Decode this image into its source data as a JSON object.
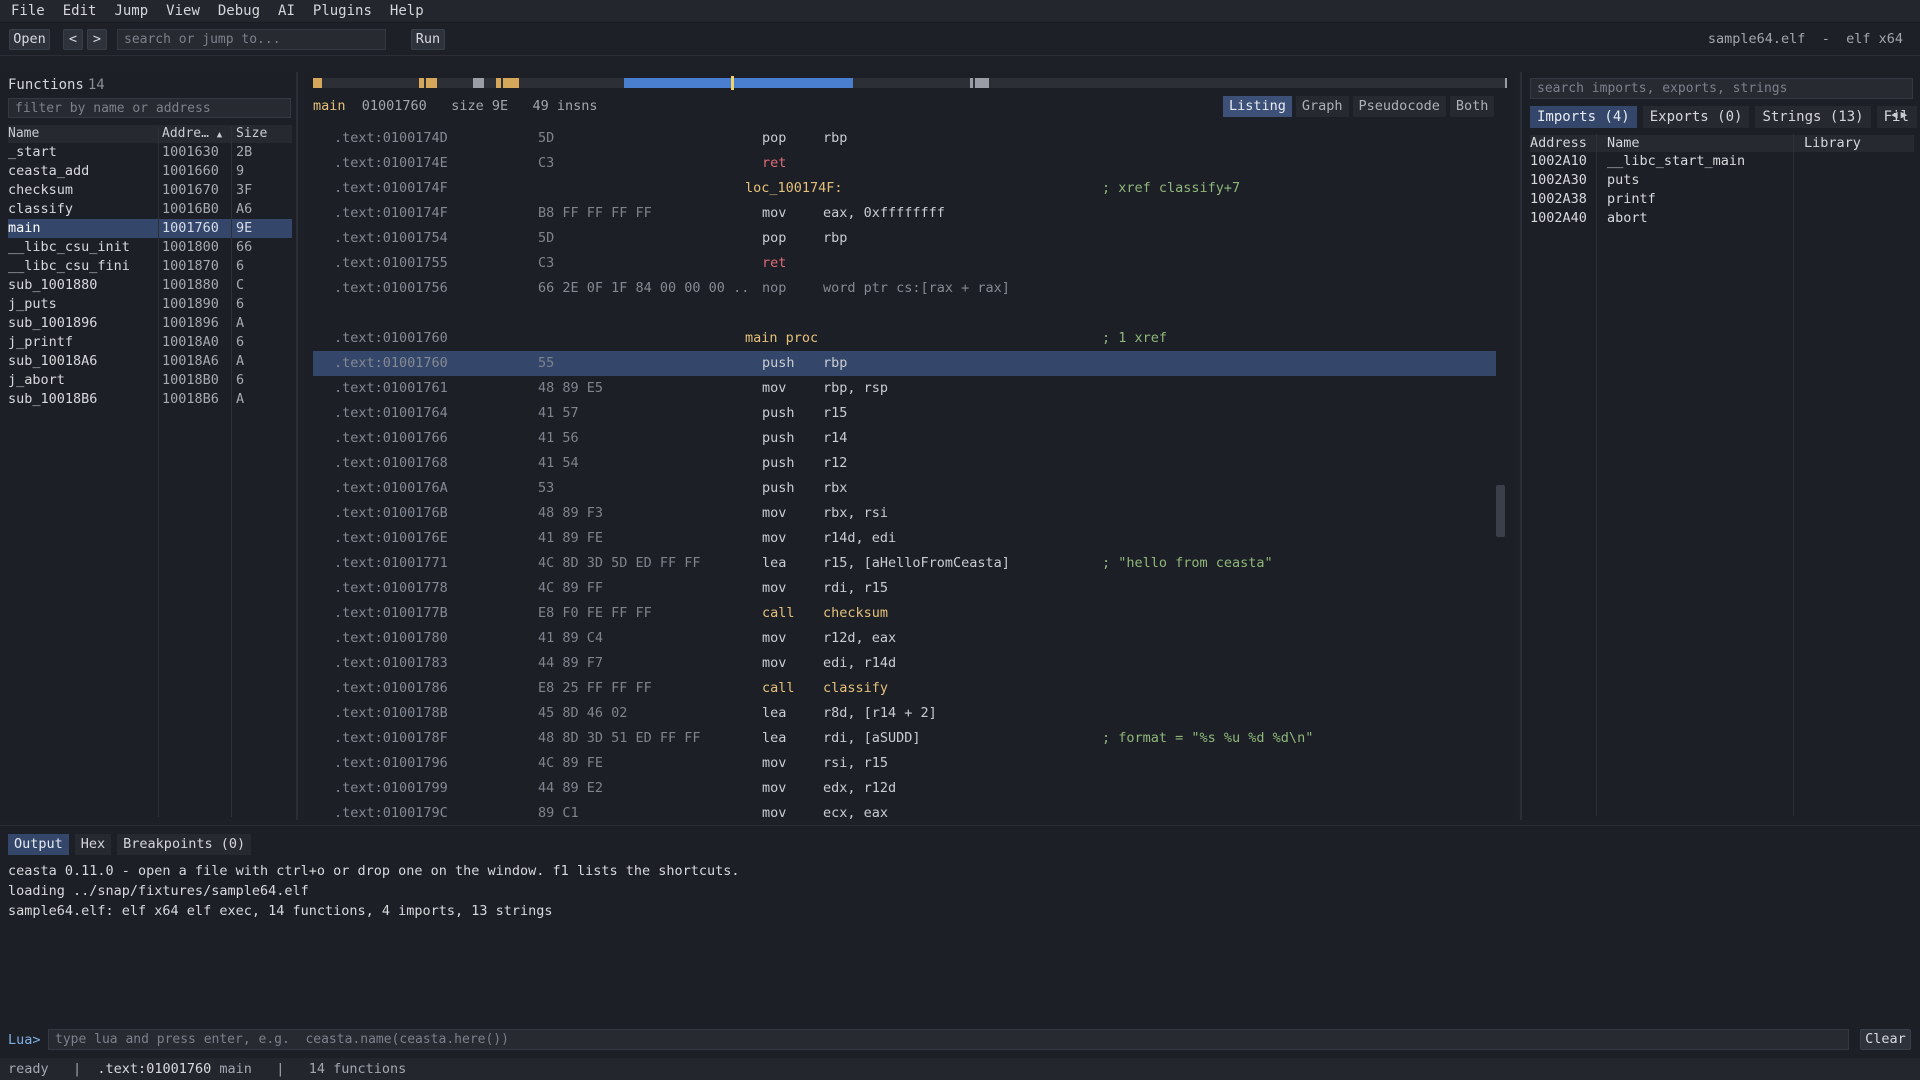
{
  "menubar": {
    "items": [
      "File",
      "Edit",
      "Jump",
      "View",
      "Debug",
      "AI",
      "Plugins",
      "Help"
    ]
  },
  "toolbar": {
    "open_label": "Open",
    "back_label": "<",
    "forward_label": ">",
    "search_placeholder": "search or jump to...",
    "run_label": "Run",
    "file_name": "sample64.elf",
    "file_sep": "  -  ",
    "file_format": "elf x64"
  },
  "functions": {
    "title": "Functions",
    "count": "14",
    "filter_placeholder": "filter by name or address",
    "columns": {
      "name": "Name",
      "address": "Addre…",
      "sort_indicator": "▲",
      "size": "Size"
    },
    "rows": [
      {
        "name": "_start",
        "address": "1001630",
        "size": "2B"
      },
      {
        "name": "ceasta_add",
        "address": "1001660",
        "size": "9"
      },
      {
        "name": "checksum",
        "address": "1001670",
        "size": "3F"
      },
      {
        "name": "classify",
        "address": "10016B0",
        "size": "A6"
      },
      {
        "name": "main",
        "address": "1001760",
        "size": "9E"
      },
      {
        "name": "__libc_csu_init",
        "address": "1001800",
        "size": "66"
      },
      {
        "name": "__libc_csu_fini",
        "address": "1001870",
        "size": "6"
      },
      {
        "name": "sub_1001880",
        "address": "1001880",
        "size": "C"
      },
      {
        "name": "j_puts",
        "address": "1001890",
        "size": "6"
      },
      {
        "name": "sub_1001896",
        "address": "1001896",
        "size": "A"
      },
      {
        "name": "j_printf",
        "address": "10018A0",
        "size": "6"
      },
      {
        "name": "sub_10018A6",
        "address": "10018A6",
        "size": "A"
      },
      {
        "name": "j_abort",
        "address": "10018B0",
        "size": "6"
      },
      {
        "name": "sub_10018B6",
        "address": "10018B6",
        "size": "A"
      }
    ]
  },
  "listing": {
    "func_name": "main",
    "func_addr": "01001760",
    "size_text": "size 9E",
    "insns_text": "49 insns",
    "view_tabs": [
      "Listing",
      "Graph",
      "Pseudocode",
      "Both"
    ],
    "rows": [
      {
        "addr": ".text:0100174D",
        "bytes": "5D",
        "mnem": "pop",
        "ops": "rbp"
      },
      {
        "addr": ".text:0100174E",
        "bytes": "C3",
        "mnem": "ret",
        "ops": ""
      },
      {
        "addr": ".text:0100174F",
        "label": "loc_100174F:",
        "comment": "; xref classify+7"
      },
      {
        "addr": ".text:0100174F",
        "bytes": "B8 FF FF FF FF",
        "mnem": "mov",
        "ops": "eax, 0xffffffff"
      },
      {
        "addr": ".text:01001754",
        "bytes": "5D",
        "mnem": "pop",
        "ops": "rbp"
      },
      {
        "addr": ".text:01001755",
        "bytes": "C3",
        "mnem": "ret",
        "ops": ""
      },
      {
        "addr": ".text:01001756",
        "bytes": "66 2E 0F 1F 84 00 00 00 ..",
        "mnem": "nop",
        "ops": "word ptr cs:[rax + rax]"
      },
      {
        "addr": ".text:01001760",
        "label": "main proc",
        "comment": "; 1 xref"
      },
      {
        "addr": ".text:01001760",
        "bytes": "55",
        "mnem": "push",
        "ops": "rbp"
      },
      {
        "addr": ".text:01001761",
        "bytes": "48 89 E5",
        "mnem": "mov",
        "ops": "rbp, rsp"
      },
      {
        "addr": ".text:01001764",
        "bytes": "41 57",
        "mnem": "push",
        "ops": "r15"
      },
      {
        "addr": ".text:01001766",
        "bytes": "41 56",
        "mnem": "push",
        "ops": "r14"
      },
      {
        "addr": ".text:01001768",
        "bytes": "41 54",
        "mnem": "push",
        "ops": "r12"
      },
      {
        "addr": ".text:0100176A",
        "bytes": "53",
        "mnem": "push",
        "ops": "rbx"
      },
      {
        "addr": ".text:0100176B",
        "bytes": "48 89 F3",
        "mnem": "mov",
        "ops": "rbx, rsi"
      },
      {
        "addr": ".text:0100176E",
        "bytes": "41 89 FE",
        "mnem": "mov",
        "ops": "r14d, edi"
      },
      {
        "addr": ".text:01001771",
        "bytes": "4C 8D 3D 5D ED FF FF",
        "mnem": "lea",
        "ops": "r15, [aHelloFromCeasta]",
        "comment": "; \"hello from ceasta\""
      },
      {
        "addr": ".text:01001778",
        "bytes": "4C 89 FF",
        "mnem": "mov",
        "ops": "rdi, r15"
      },
      {
        "addr": ".text:0100177B",
        "bytes": "E8 F0 FE FF FF",
        "mnem": "call",
        "ops": "checksum"
      },
      {
        "addr": ".text:01001780",
        "bytes": "41 89 C4",
        "mnem": "mov",
        "ops": "r12d, eax"
      },
      {
        "addr": ".text:01001783",
        "bytes": "44 89 F7",
        "mnem": "mov",
        "ops": "edi, r14d"
      },
      {
        "addr": ".text:01001786",
        "bytes": "E8 25 FF FF FF",
        "mnem": "call",
        "ops": "classify"
      },
      {
        "addr": ".text:0100178B",
        "bytes": "45 8D 46 02",
        "mnem": "lea",
        "ops": "r8d, [r14 + 2]"
      },
      {
        "addr": ".text:0100178F",
        "bytes": "48 8D 3D 51 ED FF FF",
        "mnem": "lea",
        "ops": "rdi, [aSUDD]",
        "comment": "; format = \"%s %u %d %d\\n\""
      },
      {
        "addr": ".text:01001796",
        "bytes": "4C 89 FE",
        "mnem": "mov",
        "ops": "rsi, r15"
      },
      {
        "addr": ".text:01001799",
        "bytes": "44 89 E2",
        "mnem": "mov",
        "ops": "edx, r12d"
      },
      {
        "addr": ".text:0100179C",
        "bytes": "89 C1",
        "mnem": "mov",
        "ops": "ecx, eax"
      }
    ]
  },
  "symbols": {
    "search_placeholder": "search imports, exports, strings",
    "tabs": [
      "Imports (4)",
      "Exports (0)",
      "Strings (13)",
      "Fil"
    ],
    "columns": {
      "address": "Address",
      "name": "Name",
      "library": "Library"
    },
    "imports": [
      {
        "address": "1002A10",
        "name": "__libc_start_main",
        "library": ""
      },
      {
        "address": "1002A30",
        "name": "puts",
        "library": ""
      },
      {
        "address": "1002A38",
        "name": "printf",
        "library": ""
      },
      {
        "address": "1002A40",
        "name": "abort",
        "library": ""
      }
    ]
  },
  "bottom": {
    "tabs": [
      "Output",
      "Hex",
      "Breakpoints (0)"
    ],
    "log": [
      "ceasta 0.11.0 - open a file with ctrl+o or drop one on the window. f1 lists the shortcuts.",
      "loading ../snap/fixtures/sample64.elf",
      "sample64.elf: elf x64 elf exec, 14 functions, 4 imports, 13 strings"
    ],
    "lua_prompt": "Lua>",
    "lua_placeholder": "type lua and press enter, e.g.  ceasta.name(ceasta.here())",
    "clear_label": "Clear"
  },
  "statusbar": {
    "state": "ready",
    "location": ".text:01001760",
    "function": "main",
    "functions_count": "14 functions"
  },
  "colors": {
    "accent": "#34476a",
    "label": "#e5c07b",
    "comment": "#8fb77a",
    "ret": "#e06c75",
    "strip_code": "#4a7fd0",
    "strip_data": "#d4a75a",
    "strip_other": "#9a9da5"
  }
}
